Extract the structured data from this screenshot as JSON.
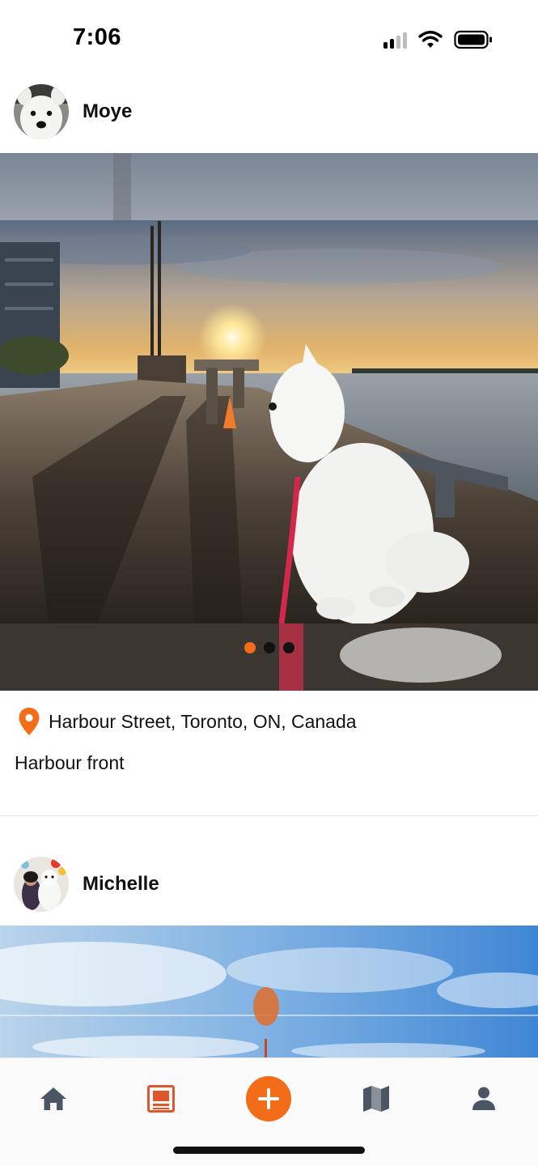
{
  "status_bar": {
    "time": "7:06",
    "icons": [
      "cellular-signal-icon",
      "wifi-icon",
      "battery-icon"
    ]
  },
  "feed": {
    "posts": [
      {
        "username": "Moye",
        "avatar": "dog-avatar",
        "carousel": {
          "count": 3,
          "active_index": 0
        },
        "location": "Harbour Street, Toronto, ON, Canada",
        "caption": "Harbour front"
      },
      {
        "username": "Michelle",
        "avatar": "person-with-dog-avatar"
      }
    ]
  },
  "tab_bar": {
    "tabs": [
      {
        "name": "home",
        "icon": "home-icon",
        "active": false
      },
      {
        "name": "feed",
        "icon": "feed-icon",
        "active": true
      },
      {
        "name": "add",
        "icon": "plus-icon",
        "active": false
      },
      {
        "name": "map",
        "icon": "map-icon",
        "active": false
      },
      {
        "name": "profile",
        "icon": "person-icon",
        "active": false
      }
    ]
  },
  "colors": {
    "accent": "#f36c17",
    "icon_inactive": "#4b5563",
    "dot_inactive": "#111111"
  }
}
